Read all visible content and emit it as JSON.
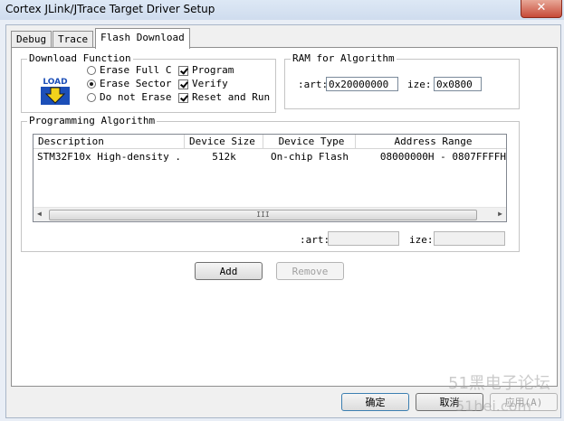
{
  "window": {
    "title": "Cortex JLink/JTrace Target Driver Setup",
    "close_glyph": "✕"
  },
  "tabs": [
    "Debug",
    "Trace",
    "Flash Download"
  ],
  "download_function": {
    "legend": "Download Function",
    "icon_text": "LOAD",
    "erase_options": [
      "Erase Full C",
      "Erase Sector",
      "Do not Erase"
    ],
    "selected_erase": "Erase Sector",
    "checks": [
      {
        "label": "Program",
        "checked": true
      },
      {
        "label": "Verify",
        "checked": true
      },
      {
        "label": "Reset and Run",
        "checked": true
      }
    ]
  },
  "ram": {
    "legend": "RAM for Algorithm",
    "start_label": ":art:",
    "start_value": "0x20000000",
    "size_label": "ize:",
    "size_value": "0x0800"
  },
  "programming": {
    "legend": "Programming Algorithm",
    "columns": [
      "Description",
      "Device Size",
      "Device Type",
      "Address Range"
    ],
    "rows": [
      {
        "description": "STM32F10x High-density ...",
        "device_size": "512k",
        "device_type": "On-chip Flash",
        "address_range": "08000000H - 0807FFFFH"
      }
    ],
    "scroll_thumb_glyph": "III",
    "start_label": ":art:",
    "start_value": "",
    "size_label": "ize:",
    "size_value": ""
  },
  "buttons": {
    "add": "Add",
    "remove": "Remove"
  },
  "dialog_buttons": {
    "ok": "确定",
    "cancel": "取消",
    "apply": "应用(A)"
  },
  "watermark": {
    "top": "51黑电子论坛",
    "bottom": "51hei.com"
  },
  "colors": {
    "close": "#c74a38",
    "titlebar": "#dde8f5",
    "icon_blue": "#1c4fb8",
    "icon_yellow": "#f2d21c"
  }
}
